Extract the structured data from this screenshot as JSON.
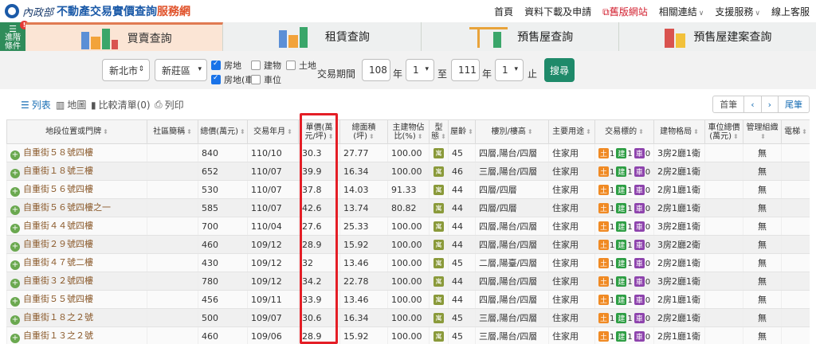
{
  "header": {
    "ministry": "內政部",
    "title": "不動產交易實價查詢",
    "title_suffix": "服務網",
    "nav": [
      {
        "label": "首頁"
      },
      {
        "label": "資料下載及申請"
      },
      {
        "label": "舊版網站"
      },
      {
        "label": "相關連結"
      },
      {
        "label": "支援服務"
      },
      {
        "label": "線上客服"
      }
    ]
  },
  "advanced_filter": {
    "label": "進階條件",
    "badge": "!"
  },
  "tabs": [
    {
      "label": "買賣查詢",
      "active": true
    },
    {
      "label": "租賃查詢",
      "active": false
    },
    {
      "label": "預售屋查詢",
      "active": false
    },
    {
      "label": "預售屋建案查詢",
      "active": false
    }
  ],
  "filters": {
    "city": "新北市",
    "district": "新莊區",
    "types": [
      {
        "label": "房地",
        "checked": true
      },
      {
        "label": "建物",
        "checked": false
      },
      {
        "label": "土地",
        "checked": false
      },
      {
        "label": "房地(車)",
        "checked": true
      },
      {
        "label": "車位",
        "checked": false
      }
    ],
    "period_label": "交易期間",
    "start_year": "108",
    "year_label": "年",
    "start_month": "1",
    "to_label": "至",
    "end_year": "111",
    "end_month": "1",
    "end_label": "止",
    "search_button": "搜尋"
  },
  "view": {
    "list": "列表",
    "map": "地圖",
    "compare": "比較清單(0)",
    "print": "列印",
    "pager": {
      "first": "首筆",
      "prev": "‹",
      "next": "›",
      "last": "尾筆"
    }
  },
  "table": {
    "headers": [
      "地段位置或門牌",
      "社區簡稱",
      "總價(萬元)",
      "交易年月",
      "單價(萬元/坪)",
      "總面積(坪)",
      "主建物佔比(%)",
      "型態",
      "屋齡",
      "樓別/樓高",
      "主要用途",
      "交易標的",
      "建物格局",
      "車位總價(萬元)",
      "管理組織",
      "電梯"
    ],
    "type_badge": "寓",
    "tag_labels": {
      "land": "土",
      "building": "建",
      "car": "車"
    },
    "rows": [
      {
        "address": "自重街５８號四樓",
        "community": "",
        "total": "840",
        "date": "110/10",
        "unit": "30.3",
        "area": "27.77",
        "ratio": "100.00",
        "age": "45",
        "floor": "四層,陽台/四層",
        "use": "住家用",
        "land": "1",
        "bld": "1",
        "car": "0",
        "layout": "3房2廳1衛",
        "car_price": "",
        "mgmt": "無",
        "elev": ""
      },
      {
        "address": "自重街１８號三樓",
        "community": "",
        "total": "652",
        "date": "110/07",
        "unit": "39.9",
        "area": "16.34",
        "ratio": "100.00",
        "age": "46",
        "floor": "三層,陽台/四層",
        "use": "住家用",
        "land": "1",
        "bld": "1",
        "car": "0",
        "layout": "2房2廳1衛",
        "car_price": "",
        "mgmt": "無",
        "elev": ""
      },
      {
        "address": "自重街５６號四樓",
        "community": "",
        "total": "530",
        "date": "110/07",
        "unit": "37.8",
        "area": "14.03",
        "ratio": "91.33",
        "age": "44",
        "floor": "四層/四層",
        "use": "住家用",
        "land": "1",
        "bld": "1",
        "car": "0",
        "layout": "2房1廳1衛",
        "car_price": "",
        "mgmt": "無",
        "elev": ""
      },
      {
        "address": "自重街５６號四樓之一",
        "community": "",
        "total": "585",
        "date": "110/07",
        "unit": "42.6",
        "area": "13.74",
        "ratio": "80.82",
        "age": "44",
        "floor": "四層/四層",
        "use": "住家用",
        "land": "1",
        "bld": "1",
        "car": "0",
        "layout": "2房1廳1衛",
        "car_price": "",
        "mgmt": "無",
        "elev": ""
      },
      {
        "address": "自重街４４號四樓",
        "community": "",
        "total": "700",
        "date": "110/04",
        "unit": "27.6",
        "area": "25.33",
        "ratio": "100.00",
        "age": "44",
        "floor": "四層,陽台/四層",
        "use": "住家用",
        "land": "1",
        "bld": "1",
        "car": "0",
        "layout": "3房2廳1衛",
        "car_price": "",
        "mgmt": "無",
        "elev": ""
      },
      {
        "address": "自重街２９號四樓",
        "community": "",
        "total": "460",
        "date": "109/12",
        "unit": "28.9",
        "area": "15.92",
        "ratio": "100.00",
        "age": "44",
        "floor": "四層,陽台/四層",
        "use": "住家用",
        "land": "1",
        "bld": "1",
        "car": "0",
        "layout": "3房2廳2衛",
        "car_price": "",
        "mgmt": "無",
        "elev": ""
      },
      {
        "address": "自重街４７號二樓",
        "community": "",
        "total": "430",
        "date": "109/12",
        "unit": "32",
        "area": "13.46",
        "ratio": "100.00",
        "age": "45",
        "floor": "二層,陽臺/四層",
        "use": "住家用",
        "land": "1",
        "bld": "1",
        "car": "0",
        "layout": "2房2廳1衛",
        "car_price": "",
        "mgmt": "無",
        "elev": ""
      },
      {
        "address": "自重街３２號四樓",
        "community": "",
        "total": "780",
        "date": "109/12",
        "unit": "34.2",
        "area": "22.78",
        "ratio": "100.00",
        "age": "44",
        "floor": "四層,陽台/四層",
        "use": "住家用",
        "land": "1",
        "bld": "1",
        "car": "0",
        "layout": "3房2廳1衛",
        "car_price": "",
        "mgmt": "無",
        "elev": ""
      },
      {
        "address": "自重街５５號四樓",
        "community": "",
        "total": "456",
        "date": "109/11",
        "unit": "33.9",
        "area": "13.46",
        "ratio": "100.00",
        "age": "44",
        "floor": "四層,陽台/四層",
        "use": "住家用",
        "land": "1",
        "bld": "1",
        "car": "0",
        "layout": "2房1廳1衛",
        "car_price": "",
        "mgmt": "無",
        "elev": ""
      },
      {
        "address": "自重街１８之２號",
        "community": "",
        "total": "500",
        "date": "109/07",
        "unit": "30.6",
        "area": "16.34",
        "ratio": "100.00",
        "age": "45",
        "floor": "三層,陽台/四層",
        "use": "住家用",
        "land": "1",
        "bld": "1",
        "car": "0",
        "layout": "2房2廳1衛",
        "car_price": "",
        "mgmt": "無",
        "elev": ""
      },
      {
        "address": "自重街１３之２號",
        "community": "",
        "total": "460",
        "date": "109/06",
        "unit": "28.9",
        "area": "15.92",
        "ratio": "100.00",
        "age": "45",
        "floor": "三層,陽台/四層",
        "use": "住家用",
        "land": "1",
        "bld": "1",
        "car": "0",
        "layout": "2房1廳1衛",
        "car_price": "",
        "mgmt": "無",
        "elev": ""
      }
    ]
  },
  "colors": {
    "accent": "#1f8a6a",
    "highlight": "#e41e26",
    "active_tab": "#fbe5d5"
  }
}
